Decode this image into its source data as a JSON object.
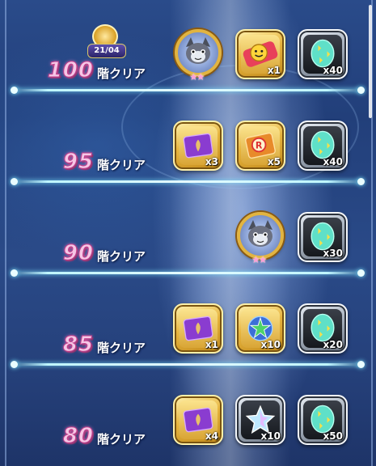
{
  "badge": {
    "date": "21/04"
  },
  "rows": [
    {
      "floor": "100",
      "label": "階クリア",
      "rewards": [
        {
          "type": "character",
          "icon": "character-icon",
          "qty": ""
        },
        {
          "type": "gold",
          "icon": "smiley-candy-icon",
          "qty": "x1"
        },
        {
          "type": "silver",
          "icon": "egg-icon",
          "qty": "x40"
        }
      ]
    },
    {
      "floor": "95",
      "label": "階クリア",
      "rewards": [
        {
          "type": "gold",
          "icon": "purple-ticket-icon",
          "qty": "x3"
        },
        {
          "type": "gold",
          "icon": "r-ticket-icon",
          "qty": "x5"
        },
        {
          "type": "silver",
          "icon": "egg-icon",
          "qty": "x40"
        }
      ]
    },
    {
      "floor": "90",
      "label": "階クリア",
      "rewards": [
        {
          "type": "character",
          "icon": "character-icon",
          "qty": ""
        },
        {
          "type": "silver",
          "icon": "egg-icon",
          "qty": "x30"
        }
      ]
    },
    {
      "floor": "85",
      "label": "階クリア",
      "rewards": [
        {
          "type": "gold",
          "icon": "purple-ticket-icon",
          "qty": "x1"
        },
        {
          "type": "gold",
          "icon": "star-orb-icon",
          "qty": "x10"
        },
        {
          "type": "silver",
          "icon": "egg-icon",
          "qty": "x20"
        }
      ]
    },
    {
      "floor": "80",
      "label": "階クリア",
      "rewards": [
        {
          "type": "gold",
          "icon": "purple-ticket-icon",
          "qty": "x4"
        },
        {
          "type": "silver",
          "icon": "crystal-star-icon",
          "qty": "x10"
        },
        {
          "type": "silver",
          "icon": "egg-icon",
          "qty": "x50"
        }
      ]
    }
  ],
  "colors": {
    "floor_text": "#f6c6e6",
    "divider": "#bff6ff",
    "gold_frame": "#e7b43d",
    "silver_frame": "#a9b3c0"
  }
}
